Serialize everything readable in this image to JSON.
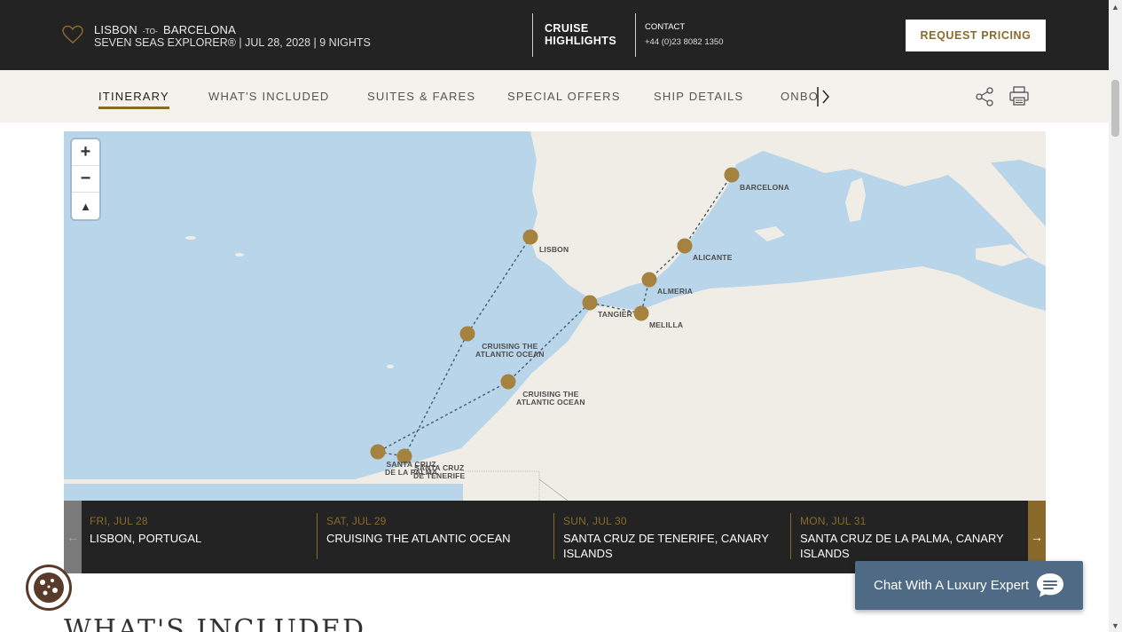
{
  "header": {
    "from": "LISBON",
    "to_word": "-TO-",
    "to": "BARCELONA",
    "subline": "SEVEN SEAS EXPLORER®  |  JUL 28, 2028  |  9 NIGHTS",
    "highlights": "CRUISE HIGHLIGHTS",
    "contact_label": "CONTACT",
    "contact_phone": "+44 (0)23 8082 1350",
    "request_button": "REQUEST PRICING",
    "favorite_icon": "heart-icon"
  },
  "nav": {
    "tabs": [
      {
        "label": "ITINERARY",
        "active": true
      },
      {
        "label": "WHAT'S INCLUDED"
      },
      {
        "label": "SUITES & FARES"
      },
      {
        "label": "SPECIAL OFFERS"
      },
      {
        "label": "SHIP DETAILS"
      },
      {
        "label": "ONBOARD"
      }
    ],
    "icons": [
      "share-icon",
      "print-icon",
      "chevron-right-icon"
    ]
  },
  "map": {
    "zoom_in": "+",
    "zoom_out": "−",
    "reset": "▲",
    "labels": {
      "barcelona": "BARCELONA",
      "lisbon": "LISBON",
      "alicante": "ALICANTE",
      "almeria": "ALMERIA",
      "tangier": "TANGIER",
      "melilla": "MELILLA",
      "cruising1_a": "CRUISING THE",
      "cruising1_b": "ATLANTIC OCEAN",
      "cruising2_a": "CRUISING THE",
      "cruising2_b": "ATLANTIC OCEAN",
      "palma_a": "SANTA CRUZ",
      "palma_b": "DE LA PALMA",
      "tenerife_a": "SANTA CRUZ",
      "tenerife_b": "DE TENERIFE"
    },
    "colors": {
      "water": "#b8d5e9",
      "land": "#f0ede7",
      "marker": "#a5823e",
      "route": "#50606e"
    }
  },
  "days": [
    {
      "date": "FRI, JUL 28",
      "place": "LISBON, PORTUGAL"
    },
    {
      "date": "SAT, JUL 29",
      "place": "CRUISING THE ATLANTIC OCEAN"
    },
    {
      "date": "SUN, JUL 30",
      "place": "SANTA CRUZ DE TENERIFE, CANARY ISLANDS"
    },
    {
      "date": "MON, JUL 31",
      "place": "SANTA CRUZ DE LA PALMA, CANARY ISLANDS"
    }
  ],
  "day_nav": {
    "prev": "←",
    "next": "→"
  },
  "section_heading": "WHAT'S INCLUDED",
  "chat": {
    "label": "Chat With A Luxury Expert",
    "icon": "chat-bubble-icon"
  },
  "cookie_icon": "cookie-icon"
}
